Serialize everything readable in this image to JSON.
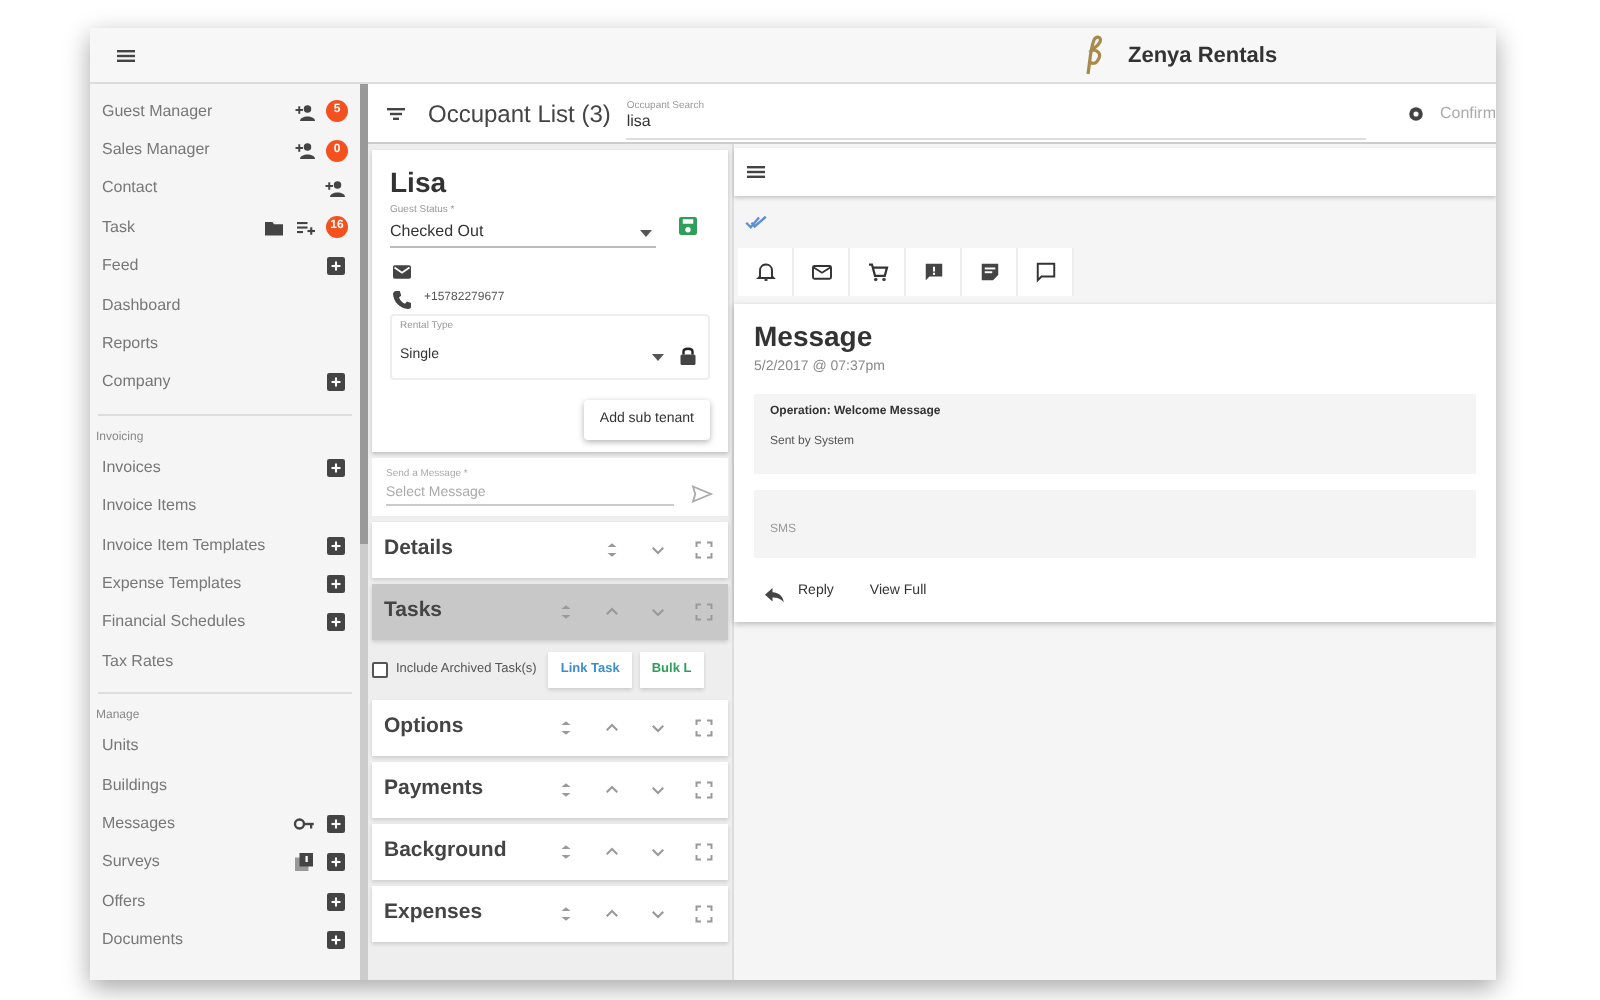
{
  "app_bar": {
    "brand": "Zenya Rentals"
  },
  "sidebar": {
    "sections": [
      {
        "items": [
          {
            "label": "Guest Manager",
            "kind": "person",
            "badge": "5",
            "add": false
          },
          {
            "label": "Sales Manager",
            "kind": "person",
            "badge": "0",
            "add": false
          },
          {
            "label": "Contact",
            "kind": "person",
            "add": false
          },
          {
            "label": "Task",
            "kind": "task",
            "badge": "16",
            "add": false
          },
          {
            "label": "Feed",
            "kind": "plain",
            "add": true
          },
          {
            "label": "Dashboard",
            "kind": "plain",
            "add": false
          },
          {
            "label": "Reports",
            "kind": "plain",
            "add": false
          },
          {
            "label": "Company",
            "kind": "plain",
            "add": true
          }
        ]
      },
      {
        "header": "Invoicing",
        "items": [
          {
            "label": "Invoices",
            "kind": "plain",
            "add": true
          },
          {
            "label": "Invoice Items",
            "kind": "plain",
            "add": false
          },
          {
            "label": "Invoice Item Templates",
            "kind": "plain",
            "add": true
          },
          {
            "label": "Expense Templates",
            "kind": "plain",
            "add": true
          },
          {
            "label": "Financial Schedules",
            "kind": "plain",
            "add": true
          },
          {
            "label": "Tax Rates",
            "kind": "plain",
            "add": false
          }
        ]
      },
      {
        "header": "Manage",
        "items": [
          {
            "label": "Units",
            "kind": "plain",
            "add": false
          },
          {
            "label": "Buildings",
            "kind": "plain",
            "add": false
          },
          {
            "label": "Messages",
            "kind": "key",
            "add": true
          },
          {
            "label": "Surveys",
            "kind": "copy",
            "add": true
          },
          {
            "label": "Offers",
            "kind": "plain",
            "add": true
          },
          {
            "label": "Documents",
            "kind": "plain",
            "add": true
          }
        ]
      }
    ]
  },
  "toolbar": {
    "title": "Occupant List (3)",
    "search": {
      "label": "Occupant Search",
      "value": "lisa"
    },
    "confirm": "Confirm"
  },
  "occupant": {
    "name": "Lisa",
    "status": {
      "label": "Guest Status *",
      "value": "Checked Out"
    },
    "phone": "+15782279677",
    "rental_type": {
      "label": "Rental Type",
      "value": "Single"
    },
    "add_button": "Add sub tenant",
    "message": {
      "label": "Send a Message *",
      "placeholder": "Select Message"
    }
  },
  "panels": [
    {
      "title": "Details",
      "selected": false
    },
    {
      "title": "Tasks",
      "selected": true,
      "include_archived": {
        "label": "Include Archived Task(s)",
        "checked": false
      },
      "buttons": [
        {
          "label": "Link Task",
          "kind": "primary"
        },
        {
          "label": "Bulk L",
          "kind": "success"
        }
      ]
    },
    {
      "title": "Options",
      "selected": false
    },
    {
      "title": "Payments",
      "selected": false
    },
    {
      "title": "Background",
      "selected": false
    },
    {
      "title": "Expenses",
      "selected": false
    }
  ],
  "message_view": {
    "tabs": [
      {
        "kind": "bell"
      },
      {
        "kind": "mail"
      },
      {
        "kind": "cart"
      },
      {
        "kind": "feedback"
      },
      {
        "kind": "note"
      },
      {
        "kind": "chat"
      }
    ],
    "title": "Message",
    "date": "5/2/2017 @ 07:37pm",
    "operation": "Operation: Welcome Message",
    "sent_by": "Sent by System",
    "channel": "SMS",
    "actions": [
      "Reply",
      "View Full"
    ]
  }
}
